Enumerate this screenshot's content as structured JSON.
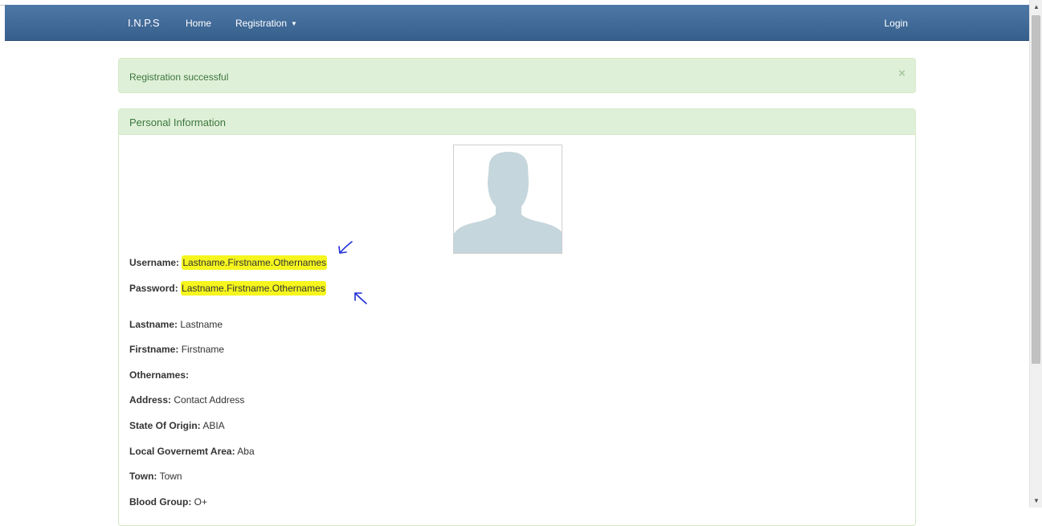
{
  "navbar": {
    "brand": "I.N.P.S",
    "home": "Home",
    "registration": "Registration",
    "login": "Login"
  },
  "alert": {
    "message": "Registration successful",
    "close": "×"
  },
  "panel": {
    "title": "Personal Information"
  },
  "credentials": {
    "username_label": "Username:",
    "username_value": "Lastname.Firstname.Othernames",
    "password_label": "Password:",
    "password_value": "Lastname.Firstname.Othernames"
  },
  "details": [
    {
      "label": "Lastname:",
      "value": "Lastname"
    },
    {
      "label": "Firstname:",
      "value": "Firstname"
    },
    {
      "label": "Othernames:",
      "value": ""
    },
    {
      "label": "Address:",
      "value": "Contact Address"
    },
    {
      "label": "State Of Origin:",
      "value": "ABIA"
    },
    {
      "label": "Local Governemt Area:",
      "value": "Aba"
    },
    {
      "label": "Town:",
      "value": "Town"
    },
    {
      "label": "Blood Group:",
      "value": "O+"
    }
  ],
  "icons": {
    "caret": "caret-down-icon",
    "close": "close-icon",
    "avatar": "user-silhouette-icon",
    "annotation": "hand-drawn-arrow-icon"
  },
  "colors": {
    "navbar": "#4e78a6",
    "success_bg": "#dff0d8",
    "success_text": "#3c763d",
    "highlight": "#f6f61e",
    "annotation": "#1f2fd6"
  }
}
